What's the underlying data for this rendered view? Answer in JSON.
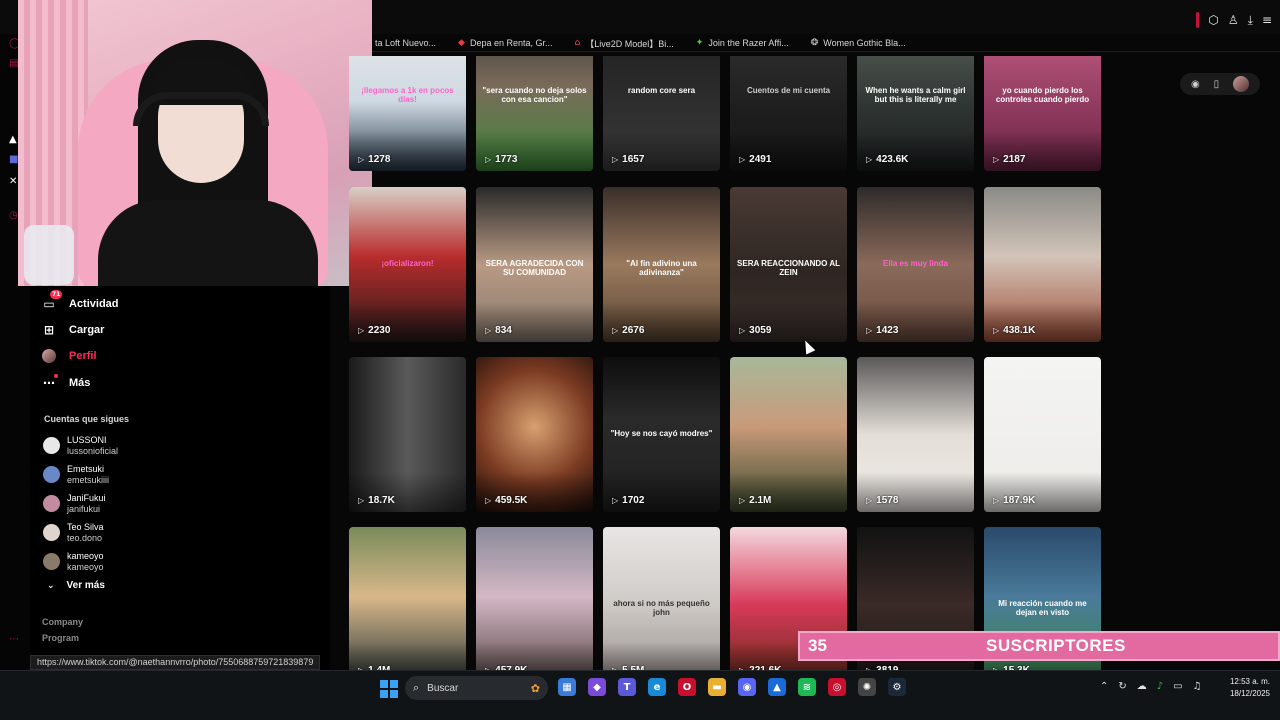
{
  "bookmarks": [
    {
      "label": "ta Loft Nuevo...",
      "icon": "folder-icon"
    },
    {
      "label": "Depa en Renta, Gr...",
      "icon": "pin-icon"
    },
    {
      "label": "【Live2D Model】Bi...",
      "icon": "house-icon"
    },
    {
      "label": "Join the Razer Affi...",
      "icon": "razer-icon"
    },
    {
      "label": "Women Gothic Bla...",
      "icon": "sparkle-icon"
    }
  ],
  "sidebar": {
    "nav": [
      {
        "label": "Actividad",
        "icon": "inbox-icon",
        "badge": "71"
      },
      {
        "label": "Cargar",
        "icon": "plus-square-icon"
      },
      {
        "label": "Perfil",
        "icon": "avatar",
        "active": true
      },
      {
        "label": "Más",
        "icon": "more-icon"
      }
    ],
    "following_heading": "Cuentas que sigues",
    "following": [
      {
        "name": "LUSSONI",
        "user": "lussonioficial",
        "color": "#e8e8e8"
      },
      {
        "name": "Emetsuki",
        "user": "emetsukiiii",
        "color": "#6a88c8"
      },
      {
        "name": "JaniFukui",
        "user": "janifukui",
        "color": "#c48aa0"
      },
      {
        "name": "Teo Silva",
        "user": "teo.dono",
        "color": "#e0d4ce"
      },
      {
        "name": "kameoyo",
        "user": "kameoyo",
        "color": "#8a7a6a"
      }
    ],
    "see_more": "Ver más",
    "footer": [
      "Company",
      "Program"
    ]
  },
  "status_url": "https://www.tiktok.com/@naethannvrro/photo/7550688759721839879",
  "grid": {
    "tiles": [
      {
        "views": "1278",
        "caption": "¡llegamos a 1k en pocos días!",
        "cap_color": "#ff63c8",
        "bg": "linear-gradient(180deg,#e9e9e9 0%,#cfd9e3 55%,#283848 100%)"
      },
      {
        "views": "1773",
        "caption": "\"sera cuando no deja solos con esa cancion\"",
        "cap_color": "#ffffff",
        "bg": "linear-gradient(180deg,#3d3a38 0%,#7a6a5a 45%,#3e8a3a 100%)"
      },
      {
        "views": "1657",
        "caption": "random core sera",
        "cap_color": "#ffffff",
        "bg": "linear-gradient(180deg,#1e1e1e 0%,#2e2e2e 60%,#3a3a3a 100%)"
      },
      {
        "views": "2491",
        "caption": "Cuentos de mi cuenta",
        "cap_color": "#cfcfcf",
        "bg": "linear-gradient(180deg,#343434 0%,#1e1e1e 60%,#151515 100%)"
      },
      {
        "views": "423.6K",
        "caption": "When he wants a calm girl but this is literally me",
        "cap_color": "#ffffff",
        "bg": "linear-gradient(180deg,#5a625a 0%,#2e3432 60%,#1a1e1e 100%)"
      },
      {
        "views": "2187",
        "caption": "yo cuando pierdo los controles cuando pierdo",
        "cap_color": "#ffffff",
        "bg": "linear-gradient(180deg,#c86088 0%,#8e3a5e 60%,#6a2444 100%)"
      },
      {
        "views": "2230",
        "caption": "¡oficializaron!",
        "cap_color": "#ff63c8",
        "bg": "linear-gradient(180deg,#d8cfc6 0%,#b82c2c 45%,#2a1a1a 100%)"
      },
      {
        "views": "834",
        "caption": "SERA AGRADECIDA CON SU COMUNIDAD",
        "cap_color": "#ffffff",
        "bg": "linear-gradient(180deg,#2a2a2a 0%,#b89a84 50%,#8a7a6e 100%)"
      },
      {
        "views": "2676",
        "caption": "\"Al fin adivino una adivinanza\"",
        "cap_color": "#ffffff",
        "bg": "linear-gradient(180deg,#3a2e2a 0%,#9a7a5e 50%,#5a4432 100%)"
      },
      {
        "views": "3059",
        "caption": "SERA REACCIONANDO AL ZEIN",
        "cap_color": "#ffffff",
        "bg": "linear-gradient(180deg,#4a3a34 0%,#2e2622 55%,#3a302c 100%)"
      },
      {
        "views": "1423",
        "caption": "Ella es muy linda",
        "cap_color": "#ff63c8",
        "bg": "linear-gradient(180deg,#2e2a2a 0%,#8a6a5a 50%,#6a4a3e 100%)"
      },
      {
        "views": "438.1K",
        "caption": "",
        "cap_color": "#ffffff",
        "bg": "linear-gradient(180deg,#8a8a86 0%,#d2c4b8 45%,#a0503a 100%)"
      },
      {
        "views": "18.7K",
        "caption": "",
        "cap_color": "#ffffff",
        "bg": "linear-gradient(90deg,#1a1a1a 0%,#5a5a5a 50%,#2a2a2a 100%)"
      },
      {
        "views": "459.5K",
        "caption": "",
        "cap_color": "#ffffff",
        "bg": "radial-gradient(circle at 50% 45%,#d8a070 0%,#7a3a22 55%,#1e0e0a 100%)"
      },
      {
        "views": "1702",
        "caption": "\"Hoy se nos cayó modres\"",
        "cap_color": "#ffffff",
        "bg": "linear-gradient(180deg,#0e0e0e 0%,#2a2a2a 40%,#1e1e1e 100%)"
      },
      {
        "views": "2.1M",
        "caption": "",
        "cap_color": "#ffffff",
        "bg": "linear-gradient(180deg,#a8b89a 0%,#c89a7a 45%,#3e4a2e 100%)"
      },
      {
        "views": "1578",
        "caption": "",
        "cap_color": "#ffffff",
        "bg": "linear-gradient(180deg,#5a5858 0%,#e4ded8 50%,#f0ece8 100%)"
      },
      {
        "views": "187.9K",
        "caption": "",
        "cap_color": "#333333",
        "bg": "linear-gradient(180deg,#f4f4f2 0%,#ecebe8 100%)"
      },
      {
        "views": "1.4M",
        "caption": "",
        "cap_color": "#ffffff",
        "bg": "linear-gradient(180deg,#7a8a5a 0%,#d8b88a 45%,#2e3a3a 100%)"
      },
      {
        "views": "457.9K",
        "caption": "",
        "cap_color": "#ffffff",
        "bg": "linear-gradient(180deg,#8a8a9a 0%,#d4b8c4 45%,#5a4a4a 100%)"
      },
      {
        "views": "5.5M",
        "caption": "ahora si no más pequeño john",
        "cap_color": "#333333",
        "bg": "linear-gradient(180deg,#e8e6e4 0%,#cfcac6 50%,#9a9290 100%)"
      },
      {
        "views": "221.6K",
        "caption": "",
        "cap_color": "#ffffff",
        "bg": "linear-gradient(180deg,#f4d8de 0%,#d83a5a 50%,#6a2a1a 100%)"
      },
      {
        "views": "3819",
        "caption": "",
        "cap_color": "#ffffff",
        "bg": "linear-gradient(180deg,#121212 0%,#3a2a28 50%,#1a1414 100%)"
      },
      {
        "views": "15.3K",
        "caption": "Mi reacción cuando me dejan en visto",
        "cap_color": "#ffffff",
        "bg": "linear-gradient(180deg,#2a4a6a 0%,#4a7a9a 45%,#3a8a4a 100%)"
      }
    ]
  },
  "subscribers": {
    "count": "35",
    "label": "SUSCRIPTORES"
  },
  "taskbar": {
    "search_placeholder": "Buscar",
    "time": "12:53 a. m.",
    "date": "18/12/2025",
    "apps": [
      {
        "icon": "calendar-icon",
        "glyph": "▦",
        "color": "#3a7ad8"
      },
      {
        "icon": "copilot-icon",
        "glyph": "◆",
        "color": "#7a4ad8"
      },
      {
        "icon": "teams-icon",
        "glyph": "T",
        "color": "#5a5ad8"
      },
      {
        "icon": "edge-icon",
        "glyph": "e",
        "color": "#1a8ad8"
      },
      {
        "icon": "opera-icon",
        "glyph": "O",
        "color": "#c8102e"
      },
      {
        "icon": "file-explorer-icon",
        "glyph": "▬",
        "color": "#e8b030"
      },
      {
        "icon": "discord-icon",
        "glyph": "◉",
        "color": "#5865f2"
      },
      {
        "icon": "store-icon",
        "glyph": "▲",
        "color": "#1a6ad8"
      },
      {
        "icon": "spotify-icon",
        "glyph": "≋",
        "color": "#1db954"
      },
      {
        "icon": "obs-icon",
        "glyph": "◎",
        "color": "#c8102e"
      },
      {
        "icon": "chatgpt-icon",
        "glyph": "✺",
        "color": "#444444"
      },
      {
        "icon": "steam-icon",
        "glyph": "⚙",
        "color": "#1b2838"
      }
    ]
  }
}
